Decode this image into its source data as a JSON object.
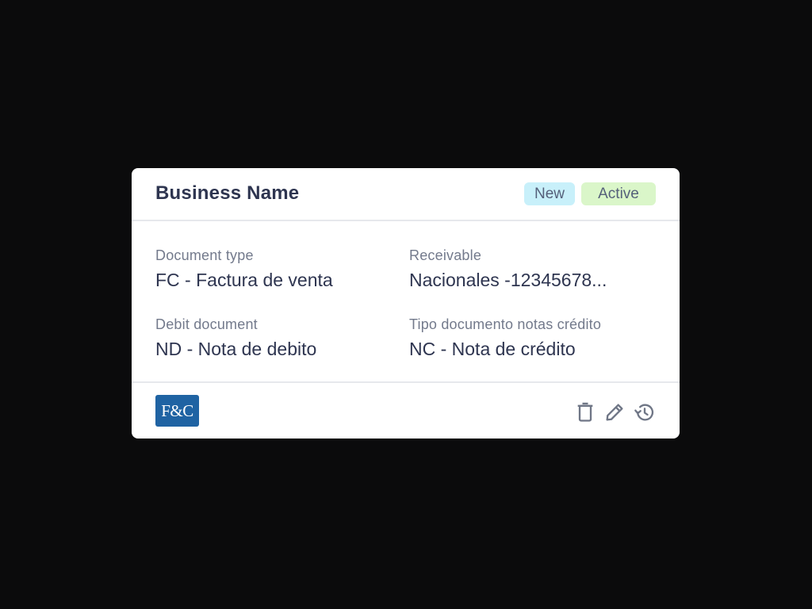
{
  "card": {
    "title": "Business Name",
    "badges": [
      {
        "label": "New",
        "color": "#c8f0fa"
      },
      {
        "label": "Active",
        "color": "#daf6c9"
      }
    ],
    "fields": [
      {
        "label": "Document type",
        "value": "FC - Factura de venta"
      },
      {
        "label": "Receivable",
        "value": "Nacionales -12345678..."
      },
      {
        "label": "Debit document",
        "value": "ND - Nota de debito"
      },
      {
        "label": "Tipo documento notas crédito",
        "value": "NC - Nota de crédito"
      }
    ],
    "footer": {
      "logo_text": "F&C",
      "logo_color": "#1f63a3",
      "actions": [
        {
          "icon": "trash-icon"
        },
        {
          "icon": "pencil-icon"
        },
        {
          "icon": "history-icon"
        }
      ]
    }
  }
}
